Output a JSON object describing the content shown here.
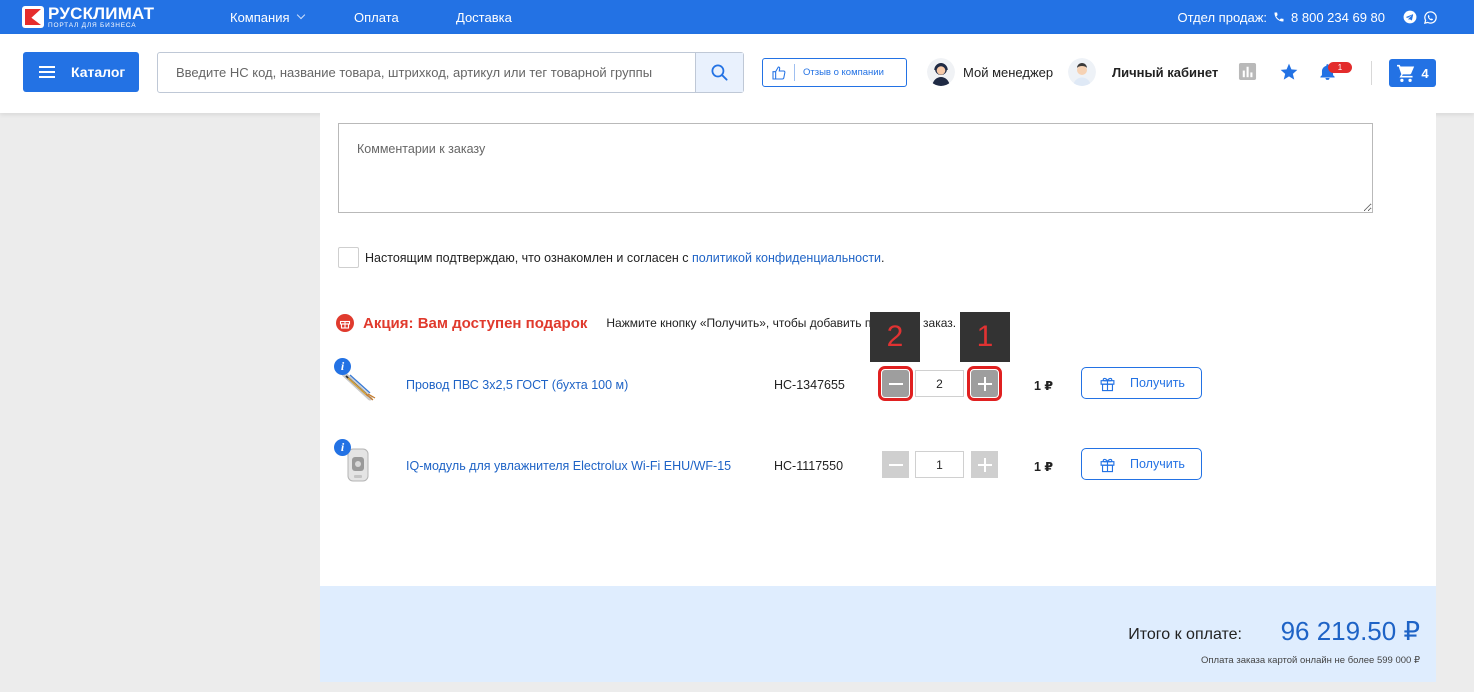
{
  "topbar": {
    "logo_name": "РУСКЛИМАТ",
    "logo_sub": "ПОРТАЛ ДЛЯ БИЗНЕСА",
    "nav": [
      "Компания",
      "Оплата",
      "Доставка"
    ],
    "sales_label": "Отдел продаж:",
    "phone": "8 800 234 69 80",
    "icons": [
      "phone-icon",
      "telegram-icon",
      "whatsapp-icon"
    ]
  },
  "header": {
    "catalog_label": "Каталог",
    "search_placeholder": "Введите НС код, название товара, штрихкод, артикул или тег товарной группы",
    "review_label": "Отзыв о компании",
    "manager_label": "Мой менеджер",
    "cabinet_label": "Личный кабинет",
    "notifications_count": "1",
    "cart_count": "4"
  },
  "order": {
    "comment_placeholder": "Комментарии к заказу",
    "agree_text": "Настоящим подтверждаю, что ознакомлен и согласен с ",
    "agree_link": "политикой конфиденциальности",
    "agree_end": "."
  },
  "promo": {
    "title": "Акция: Вам доступен подарок",
    "hint": "Нажмите кнопку «Получить», чтобы добавить подарок в заказ.",
    "items": [
      {
        "name": "Провод ПВС 3х2,5 ГОСТ (бухта 100 м)",
        "code": "НС-1347655",
        "qty": "2",
        "price": "1 ₽",
        "button": "Получить"
      },
      {
        "name": "IQ-модуль для увлажнителя Electrolux Wi-Fi EHU/WF-15",
        "code": "НС-1117550",
        "qty": "1",
        "price": "1 ₽",
        "button": "Получить"
      }
    ]
  },
  "annotations": {
    "callout_minus": "2",
    "callout_plus": "1",
    "highlight_color": "#e02020"
  },
  "total": {
    "label": "Итого к оплате:",
    "value": "96 219.50 ₽",
    "note": "Оплата заказа картой онлайн не более 599 000 ₽"
  },
  "colors": {
    "brand": "#2372e4",
    "accent_red": "#e03a2d",
    "link": "#1e63c6"
  }
}
